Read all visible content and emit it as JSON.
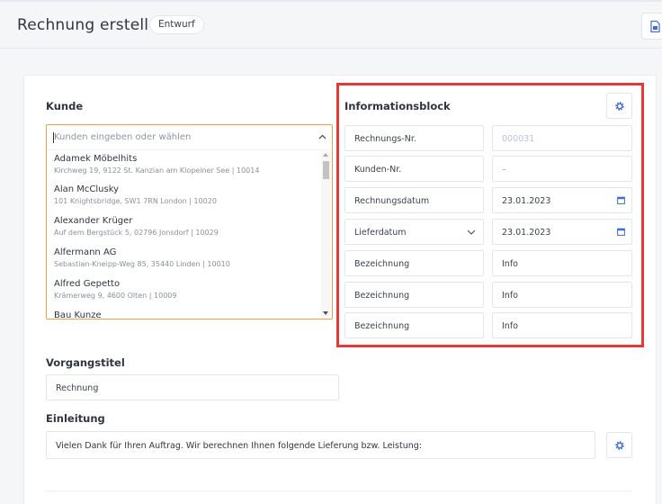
{
  "header": {
    "title": "Rechnung erstellen",
    "status_badge": "Entwurf"
  },
  "customer": {
    "label": "Kunde",
    "placeholder": "Kunden eingeben oder wählen",
    "options": [
      {
        "name": "Adamek Möbelhits",
        "address": "Kirchweg 19, 9122 St. Kanzian am Klopeiner See | 10014"
      },
      {
        "name": "Alan McClusky",
        "address": "101 Knightsbridge, SW1 7RN London | 10020"
      },
      {
        "name": "Alexander Krüger",
        "address": "Auf dem Bergstück 5, 02796 Jonsdorf | 10029"
      },
      {
        "name": "Alfermann AG",
        "address": "Sebastian-Kneipp-Weg 85, 35440 Linden | 10010"
      },
      {
        "name": "Alfred Gepetto",
        "address": "Krämerweg 9, 4600 Olten | 10009"
      },
      {
        "name": "Bau Kunze",
        "address": ""
      }
    ]
  },
  "info_block": {
    "title": "Informationsblock",
    "rows": [
      {
        "label": "Rechnungs-Nr.",
        "value": "000031"
      },
      {
        "label": "Kunden-Nr.",
        "value": "–"
      },
      {
        "label": "Rechnungsdatum",
        "value": "23.01.2023"
      },
      {
        "label": "Lieferdatum",
        "value": "23.01.2023"
      },
      {
        "label": "Bezeichnung",
        "value": "Info"
      },
      {
        "label": "Bezeichnung",
        "value": "Info"
      },
      {
        "label": "Bezeichnung",
        "value": "Info"
      }
    ]
  },
  "subject": {
    "label": "Vorgangstitel",
    "value": "Rechnung"
  },
  "intro": {
    "label": "Einleitung",
    "value": "Vielen Dank für Ihren Auftrag. Wir berechnen Ihnen folgende Lieferung bzw. Leistung:"
  },
  "colors": {
    "accent_border": "#f0a04b",
    "highlight": "#e53935",
    "icon_blue": "#3d6bd8"
  },
  "icons": [
    "document-icon",
    "chevron-up-icon",
    "gear-icon",
    "calendar-icon",
    "chevron-down-icon"
  ]
}
